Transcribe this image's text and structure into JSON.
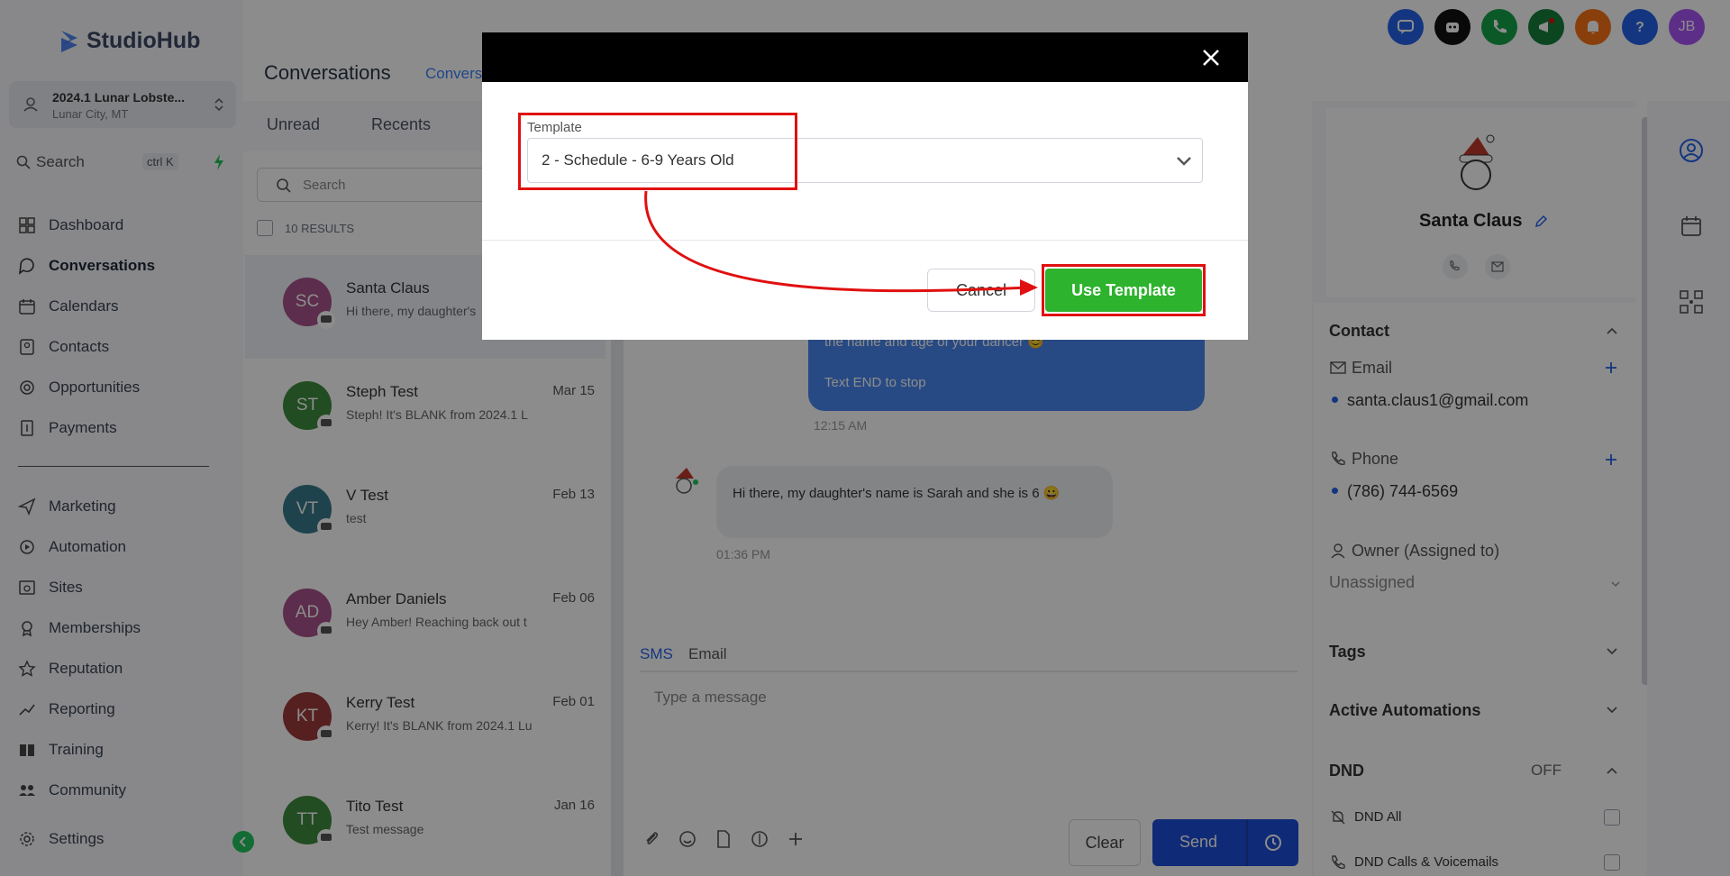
{
  "app": {
    "logo_text": "StudioHub"
  },
  "sidebar": {
    "location_name": "2024.1 Lunar Lobste...",
    "location_sub": "Lunar City, MT",
    "search_label": "Search",
    "search_shortcut": "ctrl K",
    "items": [
      {
        "label": "Dashboard",
        "icon": "dashboard-icon"
      },
      {
        "label": "Conversations",
        "icon": "chat-icon"
      },
      {
        "label": "Calendars",
        "icon": "calendar-icon"
      },
      {
        "label": "Contacts",
        "icon": "contacts-icon"
      },
      {
        "label": "Opportunities",
        "icon": "opportunities-icon"
      },
      {
        "label": "Payments",
        "icon": "payments-icon"
      },
      {
        "label": "Marketing",
        "icon": "send-icon"
      },
      {
        "label": "Automation",
        "icon": "automation-icon"
      },
      {
        "label": "Sites",
        "icon": "sites-icon"
      },
      {
        "label": "Memberships",
        "icon": "memberships-icon"
      },
      {
        "label": "Reputation",
        "icon": "star-icon"
      },
      {
        "label": "Reporting",
        "icon": "chart-icon"
      },
      {
        "label": "Training",
        "icon": "book-icon"
      },
      {
        "label": "Community",
        "icon": "community-icon"
      },
      {
        "label": "Settings",
        "icon": "gear-icon"
      }
    ]
  },
  "header": {
    "title": "Conversations",
    "tab": "Convers",
    "user_initials": "JB"
  },
  "list": {
    "tabs": [
      "Unread",
      "Recents"
    ],
    "search_placeholder": "Search",
    "results_count": "10 RESULTS",
    "items": [
      {
        "initials": "SC",
        "name": "Santa Claus",
        "preview": "Hi there, my daughter's",
        "date": "",
        "color": "#a8528a"
      },
      {
        "initials": "ST",
        "name": "Steph Test",
        "preview": "Steph! It's BLANK from 2024.1 L",
        "date": "Mar 15",
        "color": "#3f8a3f"
      },
      {
        "initials": "VT",
        "name": "V Test",
        "preview": "test",
        "date": "Feb 13",
        "color": "#3a7a8c"
      },
      {
        "initials": "AD",
        "name": "Amber Daniels",
        "preview": "Hey Amber! Reaching back out t",
        "date": "Feb 06",
        "color": "#a8528a"
      },
      {
        "initials": "KT",
        "name": "Kerry Test",
        "preview": "Kerry! It's BLANK from 2024.1 Lu",
        "date": "Feb 01",
        "color": "#9e3b3b"
      },
      {
        "initials": "TT",
        "name": "Tito Test",
        "preview": "Test message",
        "date": "Jan 16",
        "color": "#3f8a3f"
      }
    ]
  },
  "chat": {
    "outgoing_line1": "the name and age of your dancer 😊",
    "outgoing_line2": "Text END to stop",
    "outgoing_time": "12:15 AM",
    "incoming_text": "Hi there, my daughter's name is Sarah and she is 6 😀",
    "incoming_time": "01:36 PM"
  },
  "composer": {
    "tab_sms": "SMS",
    "tab_email": "Email",
    "placeholder": "Type a message",
    "clear_label": "Clear",
    "send_label": "Send"
  },
  "contact": {
    "name": "Santa Claus",
    "section_contact": "Contact",
    "email_label": "Email",
    "email_value": "santa.claus1@gmail.com",
    "phone_label": "Phone",
    "phone_value": "(786) 744-6569",
    "owner_label": "Owner (Assigned to)",
    "owner_value": "Unassigned",
    "tags_label": "Tags",
    "automations_label": "Active Automations",
    "dnd_label": "DND",
    "dnd_state": "OFF",
    "dnd_all": "DND All",
    "dnd_calls": "DND Calls & Voicemails"
  },
  "modal": {
    "template_label": "Template",
    "template_value": "2 - Schedule - 6-9 Years Old",
    "cancel_label": "Cancel",
    "use_label": "Use Template"
  },
  "colors": {
    "accent": "#3b82f6",
    "use_button": "#2db32d",
    "annotation": "#e01010"
  }
}
